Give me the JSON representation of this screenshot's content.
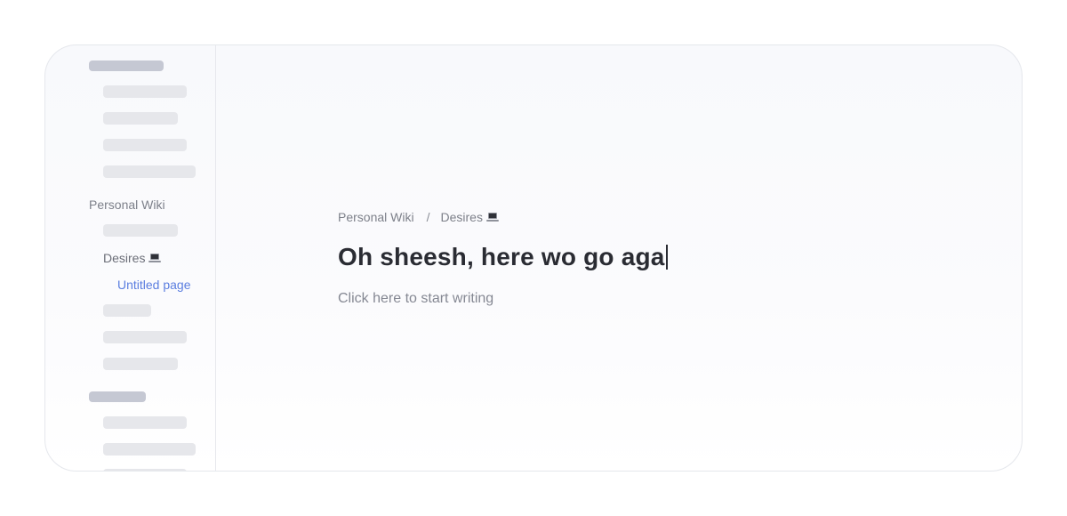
{
  "sidebar": {
    "section_label": "Personal Wiki",
    "pages": [
      {
        "label": "Desires",
        "icon": "laptop-icon"
      },
      {
        "label": "Untitled page",
        "active": true
      }
    ]
  },
  "editor": {
    "breadcrumb": {
      "items": [
        "Personal Wiki",
        "Desires"
      ],
      "separator": "/"
    },
    "title": "Oh sheesh, here wo go aga",
    "body_placeholder": "Click here to start writing"
  },
  "colors": {
    "accent": "#5b7ee0",
    "title": "#2a2c33",
    "muted_text": "#7d808a",
    "skeleton": "#e6e7eb",
    "skeleton_heading": "#c5c8d3"
  }
}
